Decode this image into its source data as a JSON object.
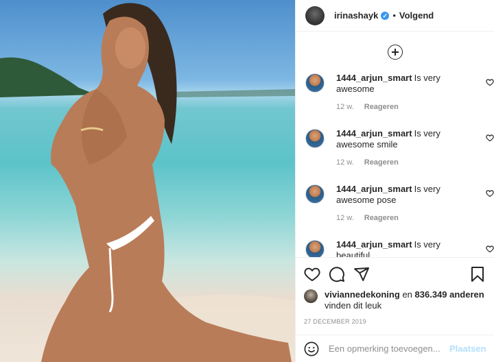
{
  "header": {
    "username": "irinashayk",
    "verified_mark": "✓",
    "separator": "•",
    "follow_label": "Volgend"
  },
  "comments": [
    {
      "user": "1444_arjun_smart",
      "text": "Is very awesome",
      "time": "12 w.",
      "reply": "Reageren"
    },
    {
      "user": "1444_arjun_smart",
      "text": "Is very awesome smile",
      "time": "12 w.",
      "reply": "Reageren"
    },
    {
      "user": "1444_arjun_smart",
      "text": "Is very awesome pose",
      "time": "12 w.",
      "reply": "Reageren"
    },
    {
      "user": "1444_arjun_smart",
      "text": "Is very beautiful",
      "time": "",
      "reply": ""
    }
  ],
  "likes": {
    "user": "viviannedekoning",
    "connector": "en",
    "count": "836.349 anderen",
    "suffix": "vinden dit leuk"
  },
  "date": "27 DECEMBER 2019",
  "composer": {
    "placeholder": "Een opmerking toevoegen...",
    "post_label": "Plaatsen"
  },
  "icons": {
    "load_more": "plus-circle-icon",
    "like": "heart-icon",
    "comment": "comment-bubble-icon",
    "share": "paper-plane-icon",
    "save": "bookmark-icon",
    "emoji": "smiley-icon"
  },
  "colors": {
    "text": "#262626",
    "muted": "#8e8e8e",
    "verified": "#3897f0",
    "post_button": "#b2dffc",
    "border": "#efefef"
  }
}
